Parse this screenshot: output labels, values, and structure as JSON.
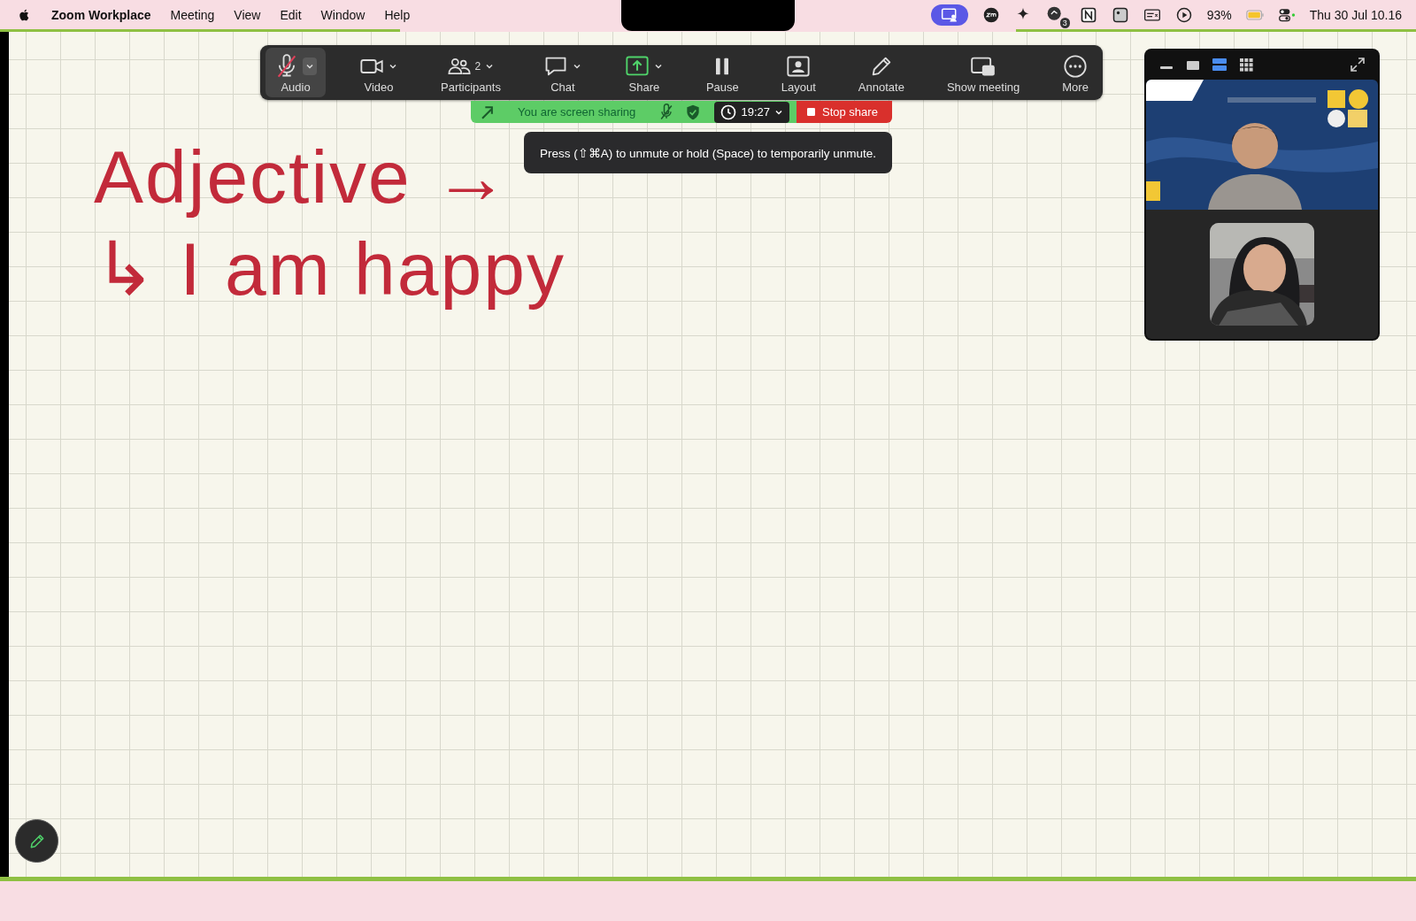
{
  "menu_bar": {
    "app": "Zoom Workplace",
    "menus": [
      "Meeting",
      "View",
      "Edit",
      "Window",
      "Help"
    ],
    "status": {
      "notification_count": "3",
      "battery_percent": "93%",
      "clock": "Thu 30 Jul  10.16"
    }
  },
  "canvas": {
    "lines": [
      "Adjective →",
      "↳ I am happy"
    ]
  },
  "toolbar": {
    "items": [
      {
        "label": "Audio",
        "selected": true,
        "muted": true,
        "has_menu": true
      },
      {
        "label": "Video",
        "selected": false,
        "muted": false,
        "has_menu": true
      },
      {
        "label": "Participants",
        "count": "2",
        "selected": false,
        "muted": false,
        "has_menu": true
      },
      {
        "label": "Chat",
        "selected": false,
        "muted": false,
        "has_menu": true
      },
      {
        "label": "Share",
        "selected": false,
        "muted": false,
        "has_menu": true
      },
      {
        "label": "Pause",
        "selected": false,
        "muted": false,
        "has_menu": false
      },
      {
        "label": "Layout",
        "selected": false,
        "muted": false,
        "has_menu": false
      },
      {
        "label": "Annotate",
        "selected": false,
        "muted": false,
        "has_menu": false
      },
      {
        "label": "Show meeting",
        "selected": false,
        "muted": false,
        "has_menu": false
      },
      {
        "label": "More",
        "selected": false,
        "muted": false,
        "has_menu": false
      }
    ]
  },
  "share_bar": {
    "status": "You are screen sharing",
    "timer": "19:27",
    "stop_label": "Stop share"
  },
  "tooltip": {
    "text": "Press (⇧⌘A) to unmute or hold (Space) to temporarily unmute."
  },
  "video_panel": {
    "view_modes": [
      {
        "selected": false
      },
      {
        "selected": false
      },
      {
        "selected": true
      },
      {
        "selected": false
      }
    ]
  }
}
